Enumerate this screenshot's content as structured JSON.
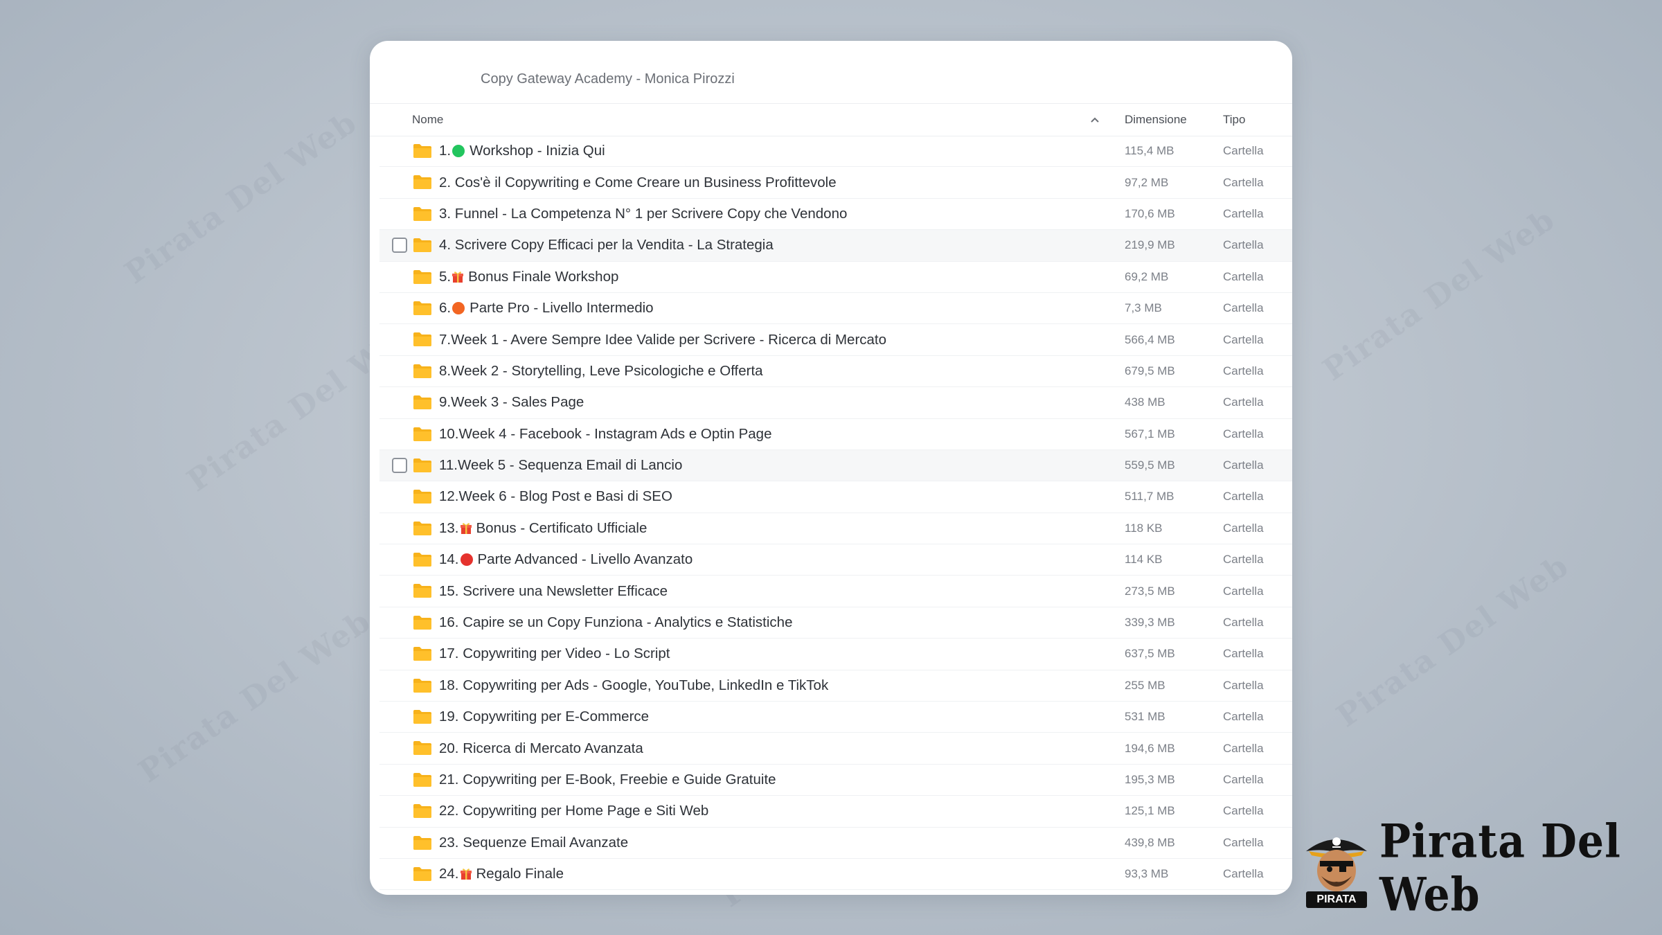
{
  "window": {
    "title": "Copy Gateway Academy - Monica Pirozzi"
  },
  "columns": {
    "name": "Nome",
    "size": "Dimensione",
    "type": "Tipo"
  },
  "sort_icon": "chevron-up-icon",
  "brand": {
    "name": "Pirata Del Web",
    "logo_label": "PIRATA"
  },
  "watermark_text": "Pirata Del Web",
  "colors": {
    "folder": "#f7b21b",
    "green_dot": "#22c55e",
    "orange_dot": "#f26522",
    "red_dot": "#e5322d"
  },
  "rows": [
    {
      "prefix": "1.",
      "emoji": "green-circle",
      "label": "Workshop - Inizia Qui",
      "size": "115,4 MB",
      "type": "Cartella",
      "highlighted": false
    },
    {
      "prefix": "",
      "emoji": "",
      "label": "2. Cos'è il Copywriting e Come Creare un Business Profittevole",
      "size": "97,2 MB",
      "type": "Cartella",
      "highlighted": false
    },
    {
      "prefix": "",
      "emoji": "",
      "label": "3. Funnel - La Competenza N° 1 per Scrivere Copy che Vendono",
      "size": "170,6 MB",
      "type": "Cartella",
      "highlighted": false
    },
    {
      "prefix": "",
      "emoji": "",
      "label": "4. Scrivere Copy Efficaci per la Vendita - La Strategia",
      "size": "219,9 MB",
      "type": "Cartella",
      "highlighted": true
    },
    {
      "prefix": "5.",
      "emoji": "gift",
      "label": "Bonus Finale Workshop",
      "size": "69,2 MB",
      "type": "Cartella",
      "highlighted": false
    },
    {
      "prefix": "6.",
      "emoji": "orange-circle",
      "label": "Parte Pro - Livello Intermedio",
      "size": "7,3 MB",
      "type": "Cartella",
      "highlighted": false
    },
    {
      "prefix": "",
      "emoji": "",
      "label": "7.Week 1 - Avere Sempre Idee Valide per Scrivere - Ricerca di Mercato",
      "size": "566,4 MB",
      "type": "Cartella",
      "highlighted": false
    },
    {
      "prefix": "",
      "emoji": "",
      "label": "8.Week 2 - Storytelling, Leve Psicologiche e Offerta",
      "size": "679,5 MB",
      "type": "Cartella",
      "highlighted": false
    },
    {
      "prefix": "",
      "emoji": "",
      "label": "9.Week 3 - Sales Page",
      "size": "438 MB",
      "type": "Cartella",
      "highlighted": false
    },
    {
      "prefix": "",
      "emoji": "",
      "label": "10.Week 4 - Facebook - Instagram Ads e Optin Page",
      "size": "567,1 MB",
      "type": "Cartella",
      "highlighted": false
    },
    {
      "prefix": "",
      "emoji": "",
      "label": "11.Week 5 - Sequenza Email di Lancio",
      "size": "559,5 MB",
      "type": "Cartella",
      "highlighted": true
    },
    {
      "prefix": "",
      "emoji": "",
      "label": "12.Week 6 - Blog Post e Basi di SEO",
      "size": "511,7 MB",
      "type": "Cartella",
      "highlighted": false
    },
    {
      "prefix": "13.",
      "emoji": "gift",
      "label": "Bonus - Certificato Ufficiale",
      "size": "118 KB",
      "type": "Cartella",
      "highlighted": false
    },
    {
      "prefix": "14.",
      "emoji": "red-circle",
      "label": "Parte Advanced - Livello Avanzato",
      "size": "114 KB",
      "type": "Cartella",
      "highlighted": false
    },
    {
      "prefix": "",
      "emoji": "",
      "label": "15. Scrivere una Newsletter Efficace",
      "size": "273,5 MB",
      "type": "Cartella",
      "highlighted": false
    },
    {
      "prefix": "",
      "emoji": "",
      "label": "16. Capire se un Copy Funziona - Analytics e Statistiche",
      "size": "339,3 MB",
      "type": "Cartella",
      "highlighted": false
    },
    {
      "prefix": "",
      "emoji": "",
      "label": "17. Copywriting per Video - Lo Script",
      "size": "637,5 MB",
      "type": "Cartella",
      "highlighted": false
    },
    {
      "prefix": "",
      "emoji": "",
      "label": "18. Copywriting per Ads - Google, YouTube, LinkedIn e TikTok",
      "size": "255 MB",
      "type": "Cartella",
      "highlighted": false
    },
    {
      "prefix": "",
      "emoji": "",
      "label": "19. Copywriting per E-Commerce",
      "size": "531 MB",
      "type": "Cartella",
      "highlighted": false
    },
    {
      "prefix": "",
      "emoji": "",
      "label": "20. Ricerca di Mercato Avanzata",
      "size": "194,6 MB",
      "type": "Cartella",
      "highlighted": false
    },
    {
      "prefix": "",
      "emoji": "",
      "label": "21. Copywriting per E-Book, Freebie e Guide Gratuite",
      "size": "195,3 MB",
      "type": "Cartella",
      "highlighted": false
    },
    {
      "prefix": "",
      "emoji": "",
      "label": "22. Copywriting per Home Page e Siti Web",
      "size": "125,1 MB",
      "type": "Cartella",
      "highlighted": false
    },
    {
      "prefix": "",
      "emoji": "",
      "label": "23. Sequenze Email Avanzate",
      "size": "439,8 MB",
      "type": "Cartella",
      "highlighted": false
    },
    {
      "prefix": "24.",
      "emoji": "gift",
      "label": "Regalo Finale",
      "size": "93,3 MB",
      "type": "Cartella",
      "highlighted": false
    }
  ]
}
